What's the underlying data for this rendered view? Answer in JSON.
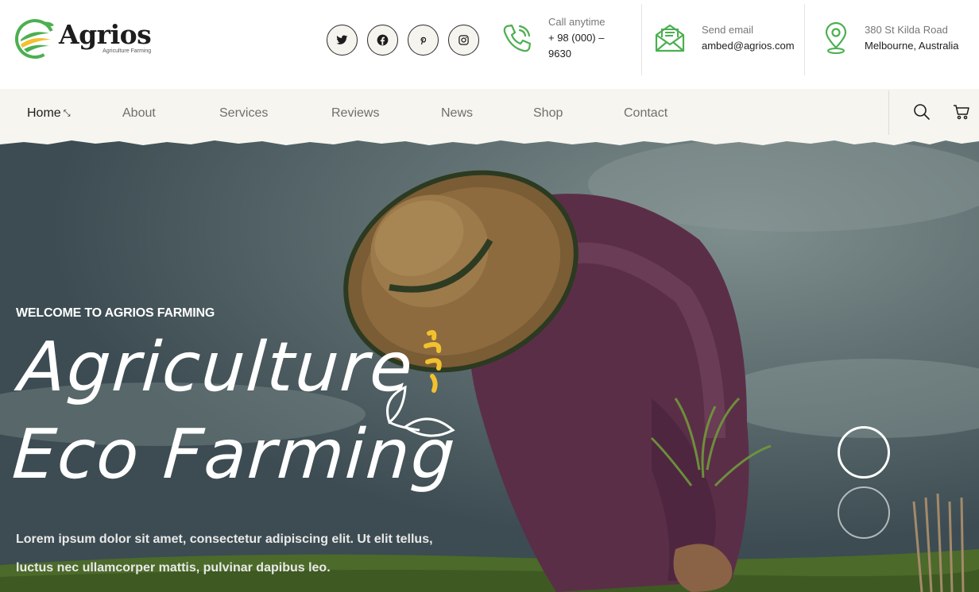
{
  "brand": {
    "name": "Agrios",
    "tagline": "Agriculture Farming",
    "colors": {
      "green": "#4caf50",
      "yellow": "#f2c12e",
      "dark": "#1d1d1d"
    }
  },
  "socials": [
    {
      "name": "twitter",
      "icon": "twitter-icon"
    },
    {
      "name": "facebook",
      "icon": "facebook-icon"
    },
    {
      "name": "pinterest",
      "icon": "pinterest-icon"
    },
    {
      "name": "instagram",
      "icon": "instagram-icon"
    }
  ],
  "contact": {
    "phone": {
      "label": "Call anytime",
      "value": "+ 98 (000) – 9630",
      "icon": "phone-icon"
    },
    "email": {
      "label": "Send email",
      "value": "ambed@agrios.com",
      "icon": "envelope-icon"
    },
    "address": {
      "line1": "380 St Kilda Road",
      "line2": "Melbourne, Australia",
      "icon": "location-pin-icon"
    }
  },
  "nav": {
    "items": [
      "Home",
      "About",
      "Services",
      "Reviews",
      "News",
      "Shop",
      "Contact"
    ],
    "active": "Home",
    "icons": [
      "search-icon",
      "cart-icon"
    ]
  },
  "hero": {
    "eyebrow": "WELCOME TO AGRIOS FARMING",
    "title_line1": "Agriculture",
    "title_line2": "Eco Farming",
    "description": "Lorem ipsum dolor sit amet, consectetur adipiscing elit. Ut elit tellus, luctus nec ullamcorper mattis, pulvinar dapibus leo.",
    "slides": 2,
    "active_slide": 1
  }
}
